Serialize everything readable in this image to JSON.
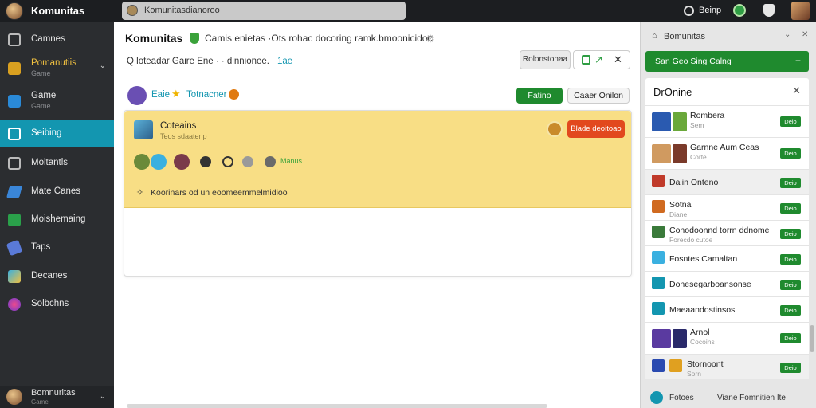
{
  "app": {
    "title": "Komunitas"
  },
  "search": {
    "text": "Komunitasdianoroo"
  },
  "topbar": {
    "user_label": "Beinp"
  },
  "sidebar": {
    "items": [
      {
        "label": "Camnes",
        "sub": "",
        "icon": "gamepad-icon",
        "color": "#3a3c40",
        "active": false
      },
      {
        "label": "Pomanutiis",
        "sub": "Game",
        "icon": "trophy-icon",
        "color": "#d9a020",
        "active": false,
        "expandable": true
      },
      {
        "label": "Game",
        "sub": "Game",
        "icon": "globe-icon",
        "color": "#2a8ad8",
        "active": false
      },
      {
        "label": "Seibing",
        "sub": "",
        "icon": "chat-icon",
        "color": "#ffffff",
        "active": true
      },
      {
        "label": "Moltantls",
        "sub": "",
        "icon": "window-icon",
        "color": "#3a3c40",
        "active": false
      },
      {
        "label": "Mate Canes",
        "sub": "",
        "icon": "arrow-icon",
        "color": "#3a86d8",
        "active": false
      },
      {
        "label": "Moishemaing",
        "sub": "",
        "icon": "controller-icon",
        "color": "#2aa04a",
        "active": false
      },
      {
        "label": "Taps",
        "sub": "",
        "icon": "pen-icon",
        "color": "#5a7ad8",
        "active": false
      },
      {
        "label": "Decanes",
        "sub": "",
        "icon": "puzzle-icon",
        "color": "#3ab0e0",
        "active": false
      },
      {
        "label": "Solbchns",
        "sub": "",
        "icon": "planet-icon",
        "color": "#c04ad0",
        "active": false
      }
    ],
    "footer": {
      "label": "Bomnuritas",
      "sub": "Game"
    }
  },
  "main": {
    "title": "Komunitas",
    "description": "Camis enietas  ·Ots rohac docoring ramk.bmoonicidoc",
    "meta_text": "Q  loteadar  Gaire   Ene  ·  ·  dinnionee.",
    "meta_count": "1ae",
    "btn_left": "Rolonstonaa",
    "community": {
      "name": "Eaie",
      "sub": "Totnacner"
    },
    "follow_label": "Fatino",
    "create_label": "Caaer Onilon",
    "card": {
      "title": "Coteains",
      "subtitle": "Teos sdaatenp",
      "pill": "Blade deoitoao",
      "emote_label": "Manus",
      "footer_text": "Koorinars od un eoomeemmelmidioo"
    }
  },
  "rpanel": {
    "header_title": "Bomunitas",
    "cta_label": "San Geo Sing Calng",
    "section_title": "DrOnine",
    "rows": [
      {
        "name": "Rombera",
        "sub": "Sem",
        "shade": false,
        "tall": true,
        "thumbs": [
          "#2a5ab0",
          "#6aa83a"
        ]
      },
      {
        "name": "Garnne Aum Ceas",
        "sub": "Corte",
        "shade": false,
        "tall": true,
        "thumbs": [
          "#d09a60",
          "#7a3a2a"
        ]
      },
      {
        "name": "Dalin Onteno",
        "sub": "",
        "shade": true,
        "tall": false,
        "thumbs": [
          "#c03a2a"
        ]
      },
      {
        "name": "Sotna",
        "sub": "Diane",
        "shade": false,
        "tall": false,
        "thumbs": [
          "#d06a20"
        ]
      },
      {
        "name": "Conodoonnd torrn ddnome",
        "sub": "Forecdo cutoe",
        "shade": false,
        "tall": false,
        "thumbs": [
          "#3a7a3a"
        ]
      },
      {
        "name": "Fosntes Camaltan",
        "sub": "",
        "shade": false,
        "tall": false,
        "thumbs": [
          "#3ab0e0"
        ]
      },
      {
        "name": "Donesegarboansonse",
        "sub": "",
        "shade": false,
        "tall": false,
        "thumbs": [
          "#1396b0"
        ]
      },
      {
        "name": "Maeaandostinsos",
        "sub": "",
        "shade": false,
        "tall": false,
        "thumbs": [
          "#1396b0"
        ]
      },
      {
        "name": "Arnol",
        "sub": "Cocoins",
        "shade": false,
        "tall": true,
        "thumbs": [
          "#5a3aa0",
          "#2a2a6a"
        ]
      },
      {
        "name": "Stornoont",
        "sub": "Sorn",
        "shade": true,
        "tall": false,
        "thumbs": [
          "#2a4ab0",
          "#e0a020"
        ]
      }
    ],
    "join_label": "Deio",
    "footer": {
      "left": "Fotoes",
      "right": "Viane   Fomnitien  Ite"
    }
  }
}
